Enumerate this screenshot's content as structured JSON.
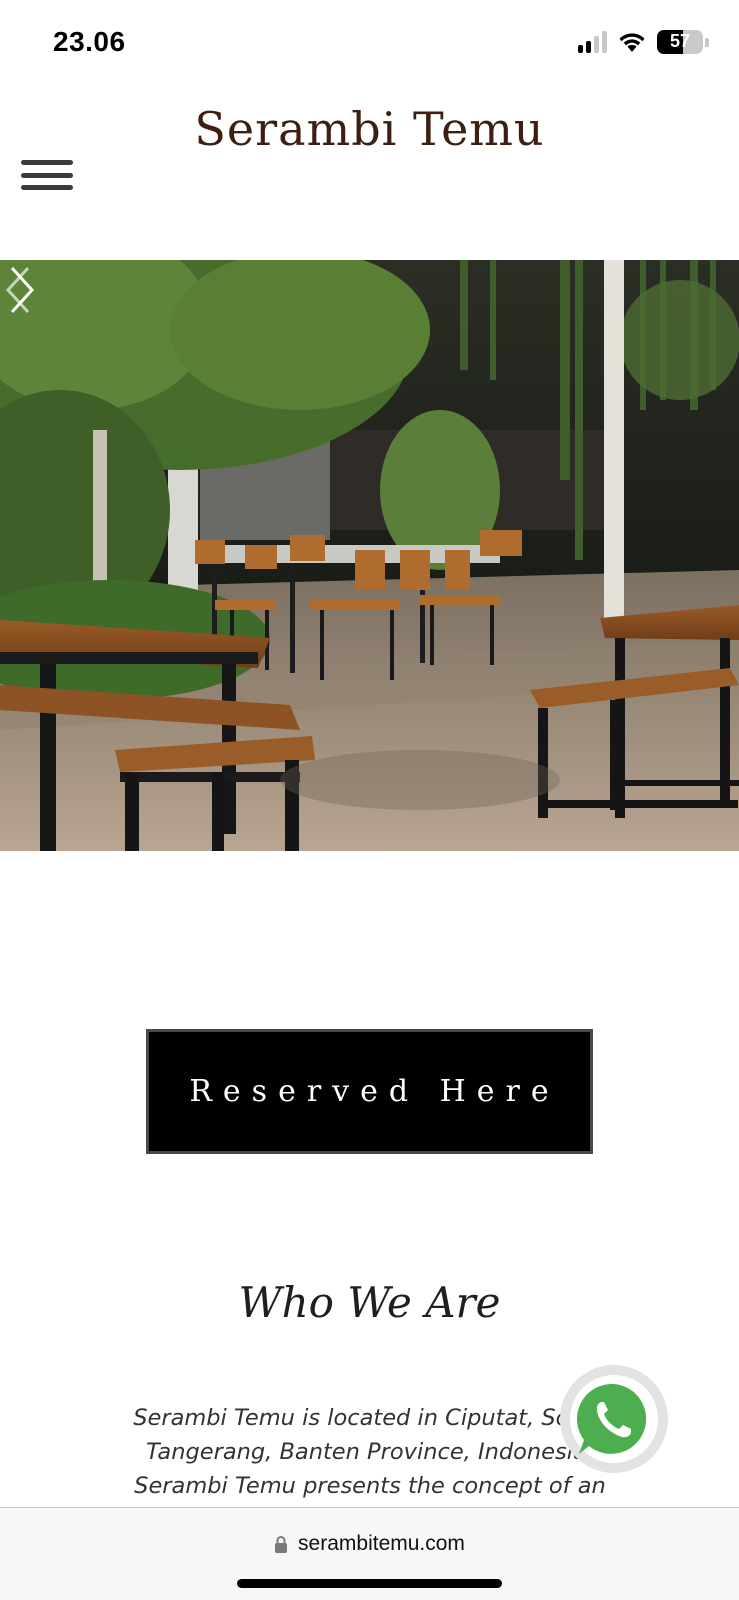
{
  "status_bar": {
    "time": "23.06",
    "battery": "57",
    "battery_level": 0.57
  },
  "header": {
    "logo": "Serambi Temu",
    "menu_icon": "hamburger-menu-icon"
  },
  "hero": {
    "prev_icon": "chevron-left-icon",
    "next_icon": "chevron-right-icon"
  },
  "cta": {
    "reserve_label": "Reserved Here"
  },
  "about": {
    "title": "Who We Are",
    "text": "Serambi Temu is located in Ciputat, South Tangerang, Banten Province, Indonesia. Serambi Temu presents the concept of an"
  },
  "whatsapp": {
    "icon": "whatsapp-icon",
    "color": "#4cae4f"
  },
  "browser": {
    "url": "serambitemu.com",
    "lock_icon": "lock-icon"
  },
  "colors": {
    "logo": "#3d1f12",
    "button_bg": "#000000"
  }
}
